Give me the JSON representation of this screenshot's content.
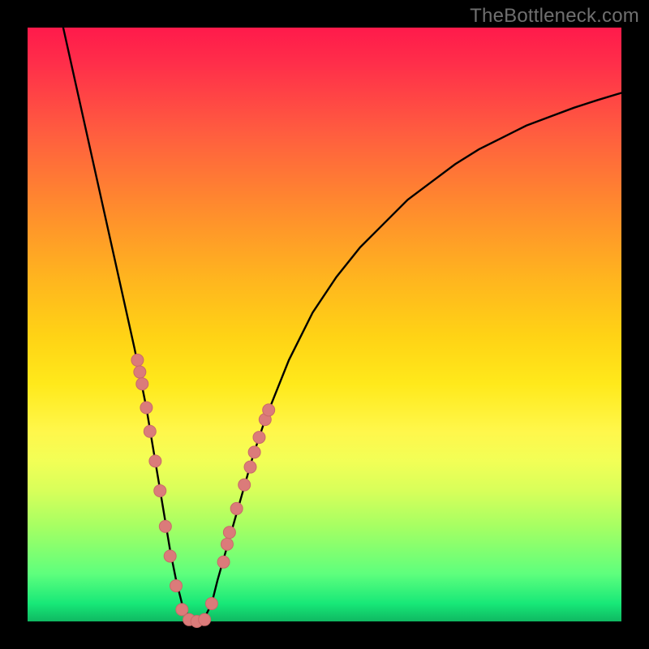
{
  "watermark": "TheBottleneck.com",
  "colors": {
    "curve_stroke": "#000000",
    "marker_fill": "#db7b7a",
    "marker_stroke": "#c96a69"
  },
  "chart_data": {
    "type": "line",
    "title": "",
    "xlabel": "",
    "ylabel": "",
    "xlim": [
      0,
      100
    ],
    "ylim": [
      0,
      100
    ],
    "series": [
      {
        "name": "bottleneck-curve",
        "x": [
          6,
          8,
          10,
          12,
          14,
          16,
          18,
          19,
          20,
          21,
          22,
          23,
          24,
          25,
          26,
          27,
          28,
          29,
          30,
          31,
          32,
          34,
          36,
          38,
          40,
          44,
          48,
          52,
          56,
          60,
          64,
          68,
          72,
          76,
          80,
          84,
          88,
          92,
          96,
          100
        ],
        "y": [
          100,
          91,
          82,
          73,
          64,
          55,
          46,
          41,
          36,
          30,
          24,
          18,
          12,
          7,
          3,
          1,
          0,
          0,
          1,
          3,
          7,
          14,
          21,
          28,
          34,
          44,
          52,
          58,
          63,
          67,
          71,
          74,
          77,
          79.5,
          81.5,
          83.5,
          85,
          86.5,
          87.8,
          89
        ]
      }
    ],
    "markers": [
      {
        "x": 18.5,
        "y": 44
      },
      {
        "x": 18.9,
        "y": 42
      },
      {
        "x": 19.3,
        "y": 40
      },
      {
        "x": 20.0,
        "y": 36
      },
      {
        "x": 20.6,
        "y": 32
      },
      {
        "x": 21.5,
        "y": 27
      },
      {
        "x": 22.3,
        "y": 22
      },
      {
        "x": 23.2,
        "y": 16
      },
      {
        "x": 24.0,
        "y": 11
      },
      {
        "x": 25.0,
        "y": 6
      },
      {
        "x": 26.0,
        "y": 2
      },
      {
        "x": 27.2,
        "y": 0.3
      },
      {
        "x": 28.5,
        "y": 0
      },
      {
        "x": 29.8,
        "y": 0.3
      },
      {
        "x": 31.0,
        "y": 3
      },
      {
        "x": 33.0,
        "y": 10
      },
      {
        "x": 33.6,
        "y": 13
      },
      {
        "x": 34.0,
        "y": 15
      },
      {
        "x": 35.2,
        "y": 19
      },
      {
        "x": 36.5,
        "y": 23
      },
      {
        "x": 37.5,
        "y": 26
      },
      {
        "x": 38.2,
        "y": 28.5
      },
      {
        "x": 39.0,
        "y": 31
      },
      {
        "x": 40.0,
        "y": 34
      },
      {
        "x": 40.6,
        "y": 35.6
      }
    ]
  }
}
